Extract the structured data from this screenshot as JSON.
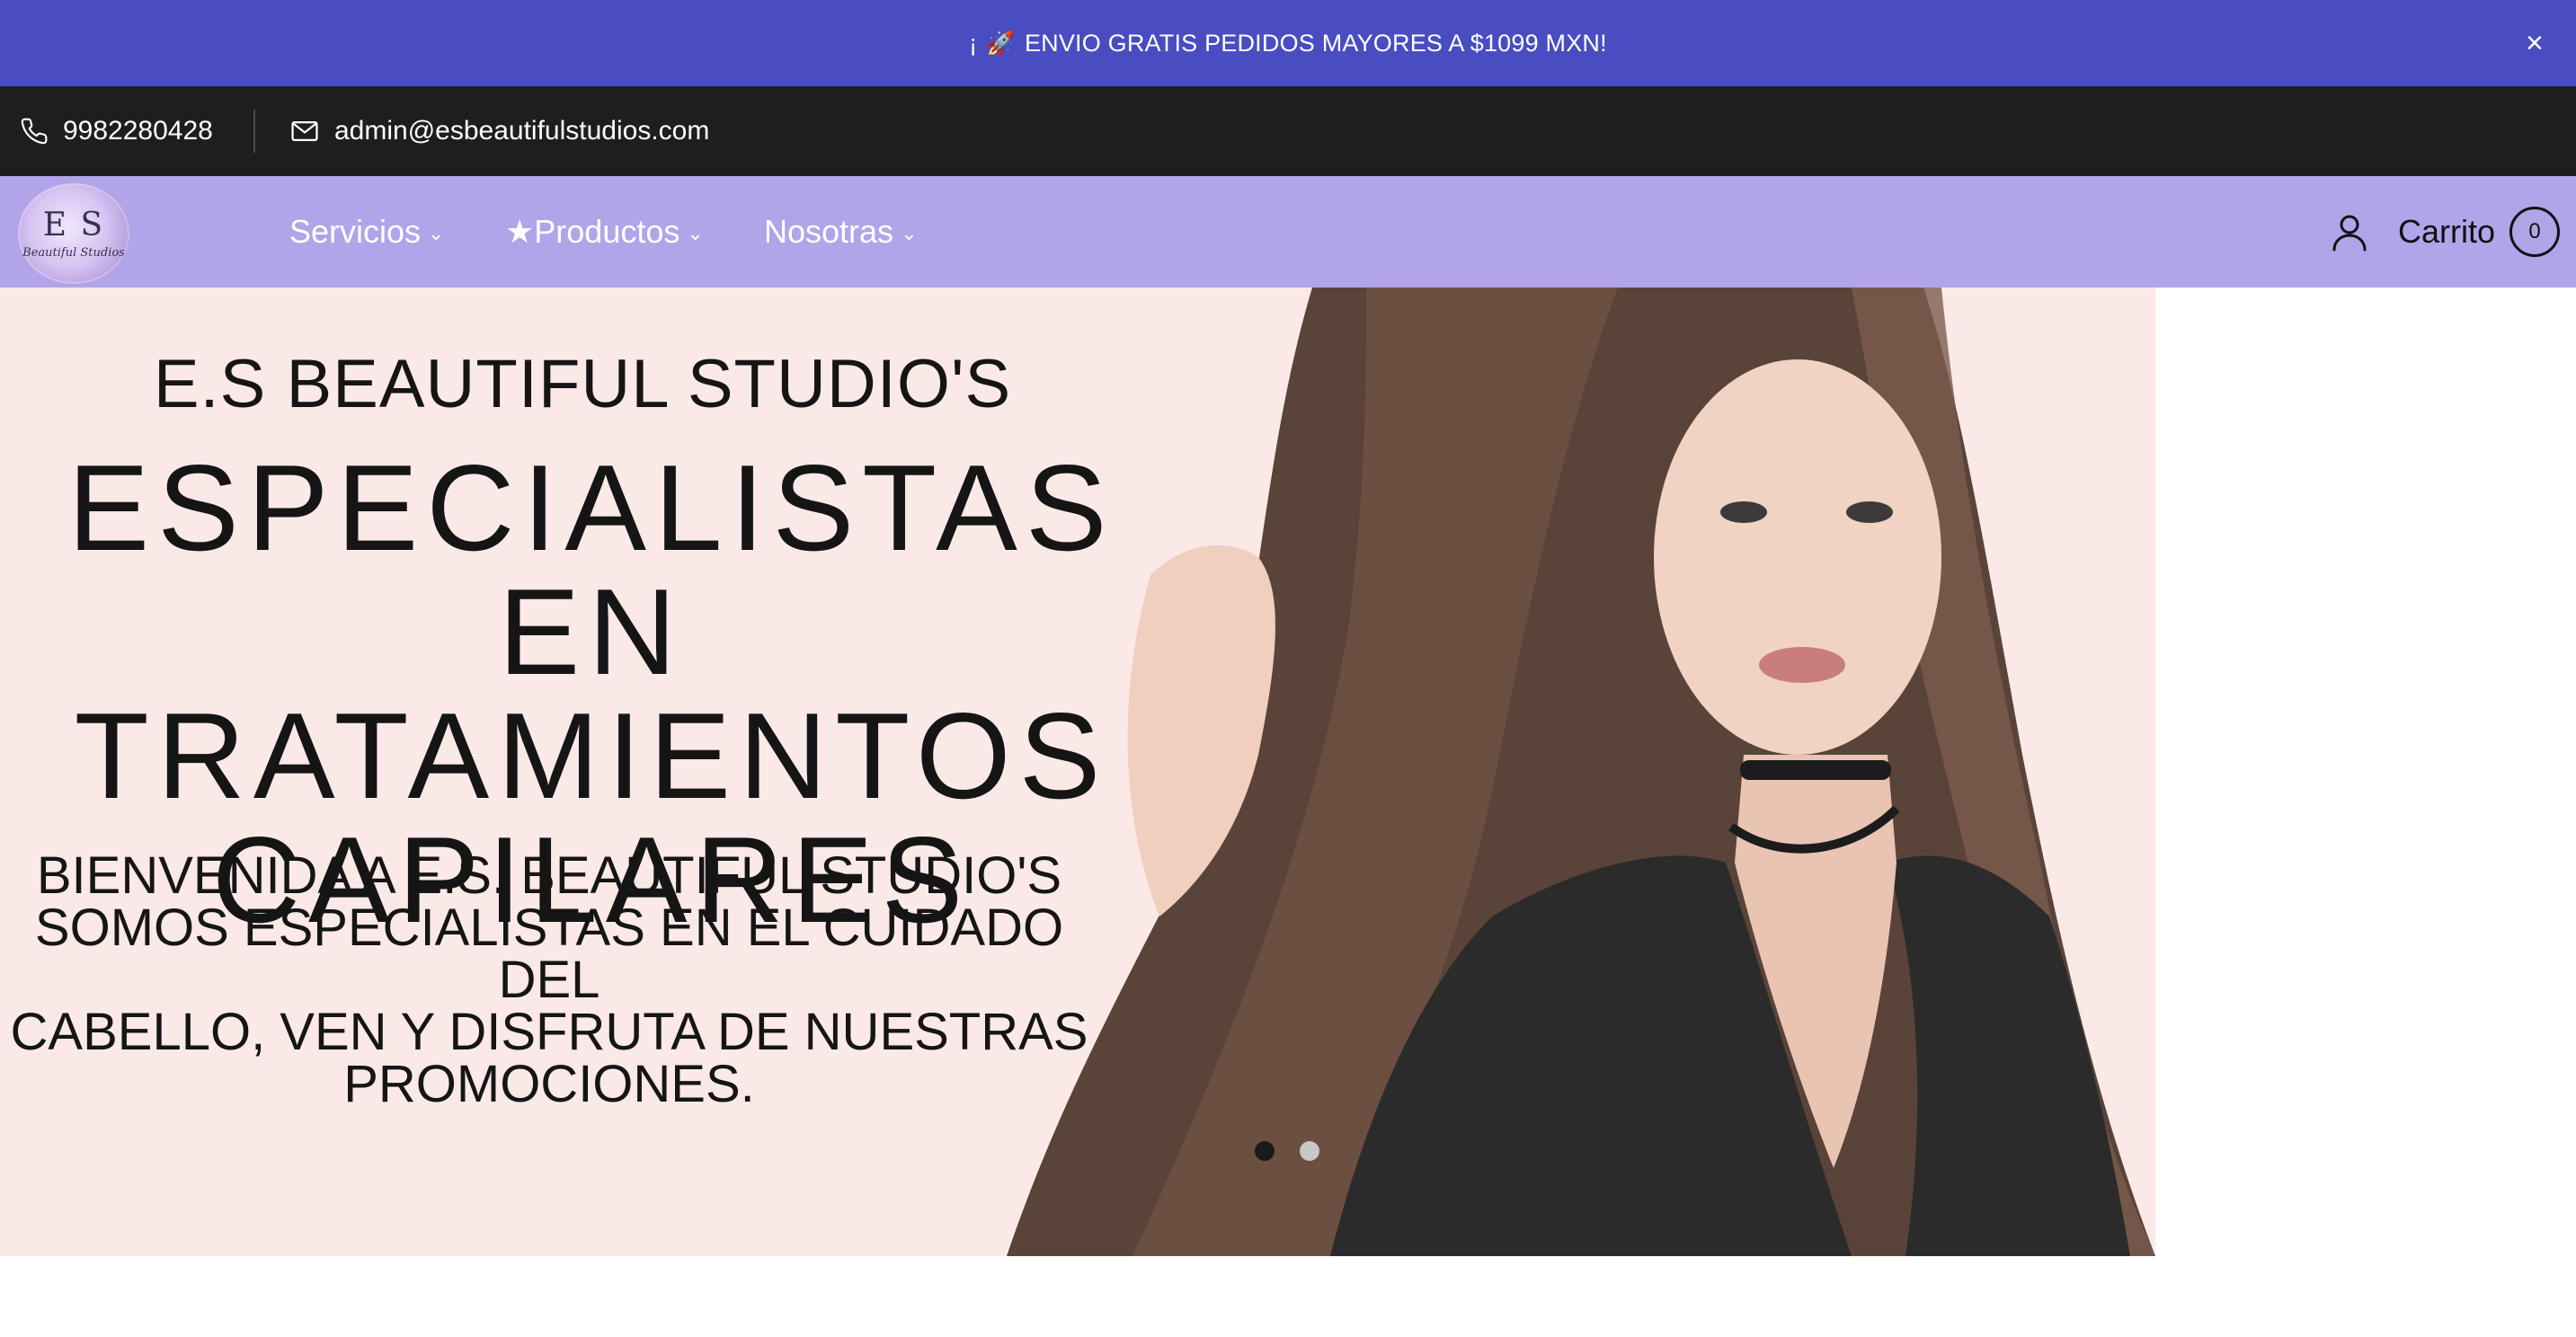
{
  "announcement": {
    "prefix": "¡",
    "rocket_icon": "🚀",
    "text": "ENVIO GRATIS PEDIDOS MAYORES A $1099 MXN!",
    "close_label": "×"
  },
  "contact": {
    "phone": "9982280428",
    "email": "admin@esbeautifulstudios.com"
  },
  "nav": {
    "logo_text": "E S",
    "logo_sub": "Beautiful Studios",
    "items": [
      {
        "label": "Servicios",
        "chevron": "⌄"
      },
      {
        "label": "★Productos",
        "chevron": "⌄"
      },
      {
        "label": "Nosotras",
        "chevron": "⌄"
      }
    ],
    "cart_label": "Carrito",
    "cart_count": "0"
  },
  "hero": {
    "brand": "E.S BEAUTIFUL STUDIO'S",
    "headline_lines": [
      "ESPECIALISTAS EN",
      "TRATAMIENTOS",
      "CAPILARES"
    ],
    "subtext_lines": [
      "BIENVENIDA A E.S. BEAUTIFUL STUDIO'S",
      "SOMOS ESPECIALISTAS EN EL CUIDADO DEL",
      "CABELLO, VEN Y DISFRUTA DE NUESTRAS",
      "PROMOCIONES."
    ],
    "slides": 2,
    "active_slide": 1
  },
  "colors": {
    "announcement_bg": "#4a4cc1",
    "contact_bg": "#1e1e1e",
    "nav_bg": "#b1a4e8",
    "hero_bg": "#fbe9e8"
  }
}
